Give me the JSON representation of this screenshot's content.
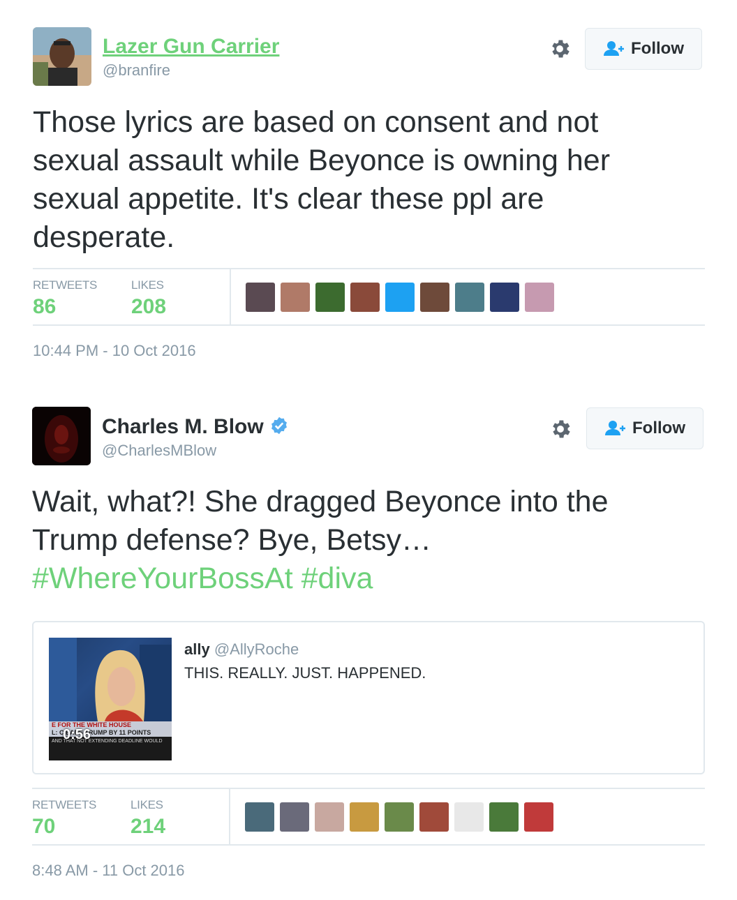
{
  "tweet1": {
    "name": "Lazer Gun Carrier",
    "handle": "@branfire",
    "follow_label": "Follow",
    "text_lines": [
      "Those lyrics are based on consent and not",
      "sexual assault while Beyonce is owning her",
      "sexual appetite. It's clear these ppl are",
      "desperate."
    ],
    "retweets_label": "RETWEETS",
    "retweets": "86",
    "likes_label": "LIKES",
    "likes": "208",
    "timestamp": "10:44 PM - 10 Oct 2016",
    "liker_avatar_colors": [
      "#5a4a52",
      "#b07a68",
      "#3c6b2f",
      "#8a4a3a",
      "#1da1f2",
      "#6e4a3a",
      "#4d7d8a",
      "#2a3a6e",
      "#c69ab0"
    ]
  },
  "tweet2": {
    "name": "Charles M. Blow",
    "handle": "@CharlesMBlow",
    "follow_label": "Follow",
    "text_lines": [
      "Wait, what?! She dragged Beyonce into the",
      "Trump defense? Bye, Betsy…"
    ],
    "hashtags": "#WhereYourBossAt #diva",
    "quote": {
      "name": "ally",
      "handle": "@AllyRoche",
      "text": "THIS. REALLY. JUST. HAPPENED.",
      "video_duration": "0:56",
      "chyron_top": "E FOR THE WHITE HOUSE",
      "chyron_main": "L: C  EADS TRUMP BY 11 POINTS",
      "chyron_small": "AND THAT NOT EXTENDING DEADLINE WOULD"
    },
    "retweets_label": "RETWEETS",
    "retweets": "70",
    "likes_label": "LIKES",
    "likes": "214",
    "timestamp": "8:48 AM - 11 Oct 2016",
    "liker_avatar_colors": [
      "#4a6a7a",
      "#6a6a7a",
      "#c8a8a0",
      "#c89a40",
      "#6a8a4a",
      "#a04a3a",
      "#e8e8e8",
      "#4a7a3a",
      "#c03a3a"
    ]
  },
  "colors": {
    "accent_green": "#6ed17a",
    "verified_blue": "#55acee",
    "muted_gray": "#8899a6",
    "text_dark": "#292f33"
  },
  "icons": {
    "settings": "gear-icon",
    "follow": "add-user-icon",
    "verified": "verified-badge-icon"
  }
}
